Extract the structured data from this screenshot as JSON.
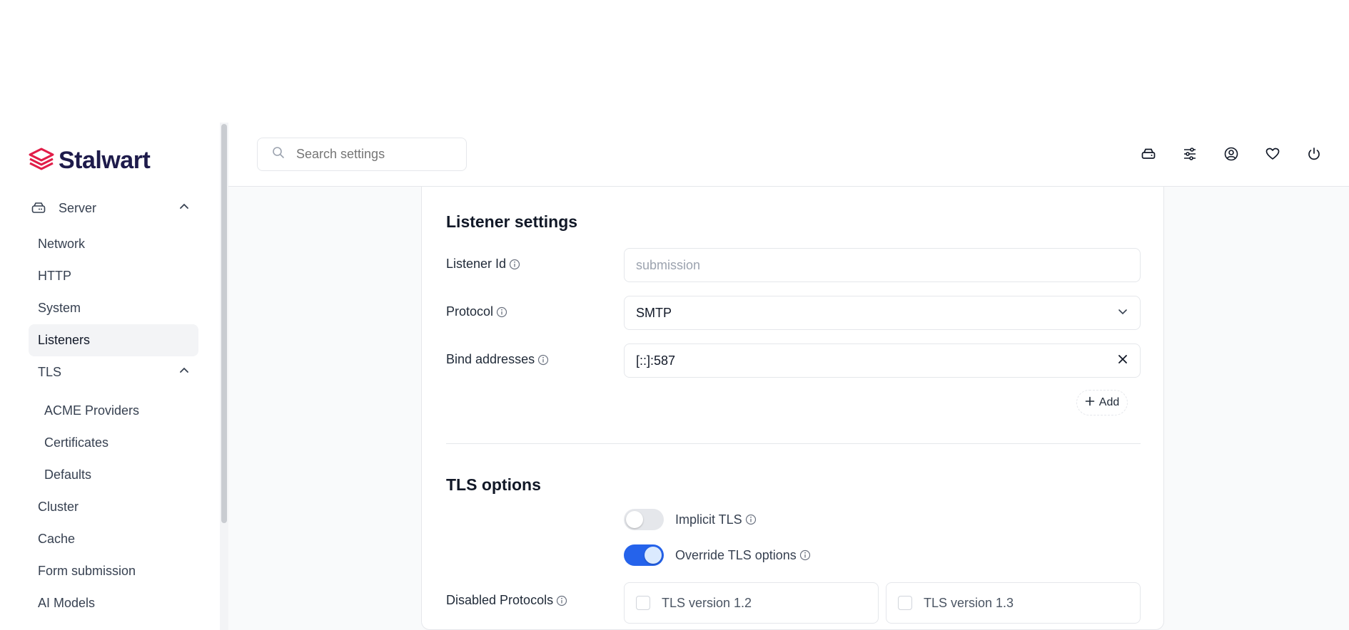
{
  "brand": {
    "name": "Stalwart",
    "accent": "#e11d48",
    "primary": "#2563eb"
  },
  "sidebar": {
    "group": {
      "label": "Server",
      "icon": "server-icon"
    },
    "items": [
      {
        "label": "Network"
      },
      {
        "label": "HTTP"
      },
      {
        "label": "System"
      },
      {
        "label": "Listeners",
        "active": true
      }
    ],
    "tls": {
      "label": "TLS",
      "children": [
        {
          "label": "ACME Providers"
        },
        {
          "label": "Certificates"
        },
        {
          "label": "Defaults"
        }
      ]
    },
    "more_items": [
      {
        "label": "Cluster"
      },
      {
        "label": "Cache"
      },
      {
        "label": "Form submission"
      },
      {
        "label": "AI Models"
      }
    ]
  },
  "header": {
    "search_placeholder": "Search settings",
    "icons": [
      "storage-icon",
      "sliders-icon",
      "account-icon",
      "heart-icon",
      "power-icon"
    ]
  },
  "listener_settings": {
    "title": "Listener settings",
    "listener_id": {
      "label": "Listener Id",
      "placeholder": "submission"
    },
    "protocol": {
      "label": "Protocol",
      "value": "SMTP"
    },
    "bind_addresses": {
      "label": "Bind addresses",
      "value": "[::]:587"
    },
    "add_label": "Add"
  },
  "tls_options": {
    "title": "TLS options",
    "implicit_tls": {
      "label": "Implicit TLS",
      "on": false
    },
    "override_tls": {
      "label": "Override TLS options",
      "on": true
    },
    "disabled_protocols": {
      "label": "Disabled Protocols",
      "options": [
        "TLS version 1.2",
        "TLS version 1.3"
      ]
    }
  }
}
